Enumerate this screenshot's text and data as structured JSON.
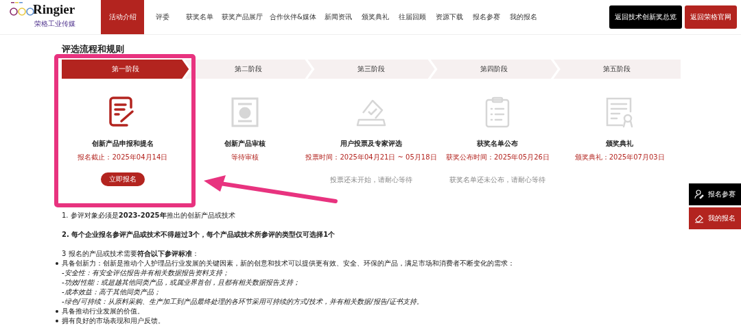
{
  "logo": {
    "brand": "Ringier",
    "subtitle": "荣格工业传媒"
  },
  "nav": [
    {
      "label": "活动介绍",
      "selected": true
    },
    {
      "label": "评委",
      "selected": false
    },
    {
      "label": "获奖名单",
      "selected": false
    },
    {
      "label": "获奖产品展厅",
      "selected": false
    },
    {
      "label": "合作伙伴&媒体",
      "selected": false
    },
    {
      "label": "新闻资讯",
      "selected": false
    },
    {
      "label": "颁奖典礼",
      "selected": false
    },
    {
      "label": "往届回顾",
      "selected": false
    },
    {
      "label": "资源下载",
      "selected": false
    },
    {
      "label": "报名参赛",
      "selected": false
    },
    {
      "label": "我的报名",
      "selected": false
    }
  ],
  "header_buttons": [
    {
      "label": "返回技术创新奖总览",
      "kind": "dark"
    },
    {
      "label": "返回荣格官网",
      "kind": "red"
    }
  ],
  "section_title": "评选流程和规则",
  "stages": [
    {
      "label": "第一阶段",
      "selected": true,
      "kind": "form",
      "title": "创新产品申报和提名",
      "subtitle": "报名截止：2025年04月14日",
      "button": "立即报名"
    },
    {
      "label": "第二阶段",
      "selected": false,
      "kind": "certificate",
      "title": "创新产品审核",
      "subtitle": "等待审核"
    },
    {
      "label": "第三阶段",
      "selected": false,
      "kind": "ballot",
      "title": "用户投票及专家评选",
      "subtitle": "投票时间：2025年04月21日 ~ 05月18日",
      "note": "投票还未开始，请耐心等待"
    },
    {
      "label": "第四阶段",
      "selected": false,
      "kind": "clipboard",
      "title": "获奖名单公布",
      "subtitle": "获奖公布时间：2025年05月26日",
      "note": "获奖名单还未公布，请耐心等待"
    },
    {
      "label": "第五阶段",
      "selected": false,
      "kind": "award",
      "title": "颁奖典礼",
      "subtitle": "颁奖典礼：2025年07月03日"
    }
  ],
  "rules": [
    {
      "kind": "numbered",
      "bold": false,
      "text": "1. 参评对象必须是**2023-2025年**推出的创新产品或技术"
    },
    {
      "kind": "numbered",
      "bold": true,
      "text": "2. 每个企业报名参评产品或技术不得超过3个，每个产品或技术所参评的类型仅可选择1个"
    },
    {
      "kind": "numbered",
      "bold": false,
      "text": "3  报名的产品或技术需要**符合以下参评标准**："
    },
    {
      "kind": "bullet",
      "bold": false,
      "text": "具备创新力：创新是推动个人护理品行业发展的关键因素，新的创意和技术可以提供更有效、安全、环保的产品，满足市场和消费者不断变化的需求："
    },
    {
      "kind": "sub",
      "bold": false,
      "text": "-安全性：有安全评估报告并有相关数据报告资料支持；"
    },
    {
      "kind": "sub",
      "bold": false,
      "text": "-功效/性能：或超越其他同类产品，或属业界首创，且都有相关数据报告支持；"
    },
    {
      "kind": "sub",
      "bold": false,
      "text": "-成本效益：高于其他同类产品；"
    },
    {
      "kind": "sub",
      "bold": false,
      "text": "-绿色/可持续：从原料采购、生产加工到产品最终处理的各环节采用可持续的方式/技术，并有相关数据/报告/证书支持。"
    },
    {
      "kind": "bullet",
      "bold": false,
      "text": "具备推动行业发展的价值。"
    },
    {
      "kind": "bullet",
      "bold": false,
      "text": "拥有良好的市场表现和用户反馈。"
    }
  ],
  "side_buttons": [
    {
      "label": "报名参赛",
      "kind": "dark"
    },
    {
      "label": "我的报名",
      "kind": "red"
    }
  ]
}
